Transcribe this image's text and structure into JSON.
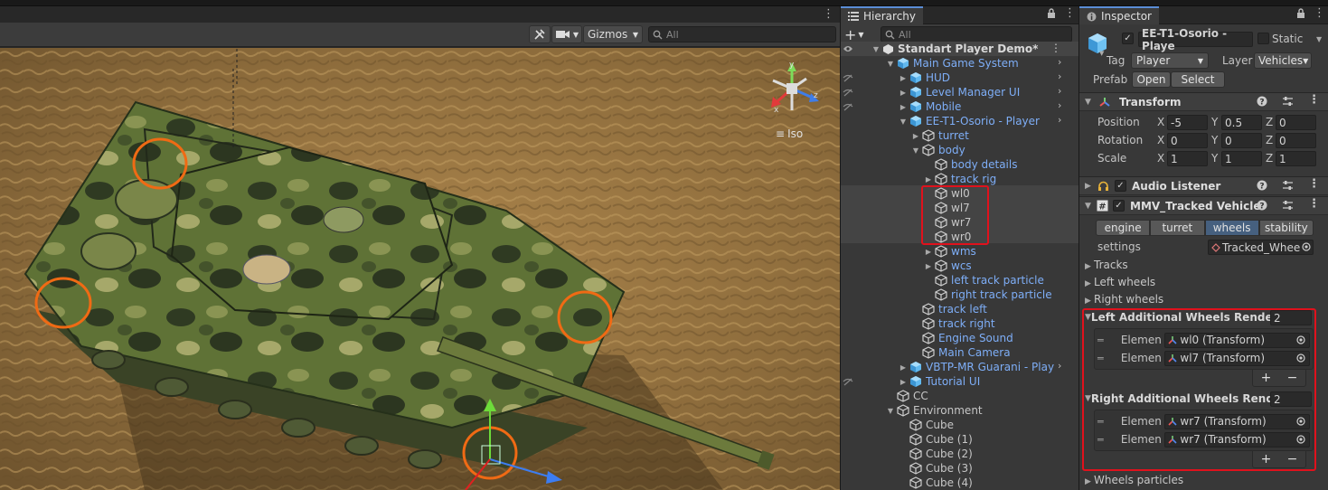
{
  "scene": {
    "gizmos_label": "Gizmos",
    "search_placeholder": "All",
    "iso_label": "Iso",
    "axis_labels": {
      "x": "x",
      "y": "y",
      "z": "z"
    }
  },
  "hierarchy": {
    "tab_label": "Hierarchy",
    "search_placeholder": "All",
    "add_label": "+",
    "scene_name": "Standart Player Demo*",
    "items": [
      {
        "label": "Main Game System",
        "depth": 1,
        "arrow": "open",
        "blue": true,
        "prefab": true,
        "more": true
      },
      {
        "label": "HUD",
        "depth": 2,
        "arrow": "closed",
        "blue": true,
        "prefab": true,
        "more": true
      },
      {
        "label": "Level Manager UI",
        "depth": 2,
        "arrow": "closed",
        "blue": true,
        "prefab": true,
        "more": true
      },
      {
        "label": "Mobile",
        "depth": 2,
        "arrow": "closed",
        "blue": true,
        "prefab": true,
        "more": true
      },
      {
        "label": "EE-T1-Osorio - Player",
        "depth": 2,
        "arrow": "open",
        "blue": true,
        "prefab": true,
        "more": true
      },
      {
        "label": "turret",
        "depth": 3,
        "arrow": "closed",
        "blue": true,
        "prefab": false
      },
      {
        "label": "body",
        "depth": 3,
        "arrow": "open",
        "blue": true,
        "prefab": false
      },
      {
        "label": "body details",
        "depth": 4,
        "arrow": "none",
        "blue": true,
        "prefab": false
      },
      {
        "label": "track rig",
        "depth": 4,
        "arrow": "closed",
        "blue": true,
        "prefab": false
      },
      {
        "label": "wl0",
        "depth": 4,
        "arrow": "none",
        "blue": false,
        "prefab": false
      },
      {
        "label": "wl7",
        "depth": 4,
        "arrow": "none",
        "blue": false,
        "prefab": false
      },
      {
        "label": "wr7",
        "depth": 4,
        "arrow": "none",
        "blue": false,
        "prefab": false
      },
      {
        "label": "wr0",
        "depth": 4,
        "arrow": "none",
        "blue": false,
        "prefab": false
      },
      {
        "label": "wms",
        "depth": 4,
        "arrow": "closed",
        "blue": true,
        "prefab": false
      },
      {
        "label": "wcs",
        "depth": 4,
        "arrow": "closed",
        "blue": true,
        "prefab": false
      },
      {
        "label": "left track particle",
        "depth": 4,
        "arrow": "none",
        "blue": true,
        "prefab": false
      },
      {
        "label": "right track particle",
        "depth": 4,
        "arrow": "none",
        "blue": true,
        "prefab": false
      },
      {
        "label": "track left",
        "depth": 3,
        "arrow": "none",
        "blue": true,
        "prefab": false
      },
      {
        "label": "track right",
        "depth": 3,
        "arrow": "none",
        "blue": true,
        "prefab": false
      },
      {
        "label": "Engine Sound",
        "depth": 3,
        "arrow": "none",
        "blue": true,
        "prefab": false
      },
      {
        "label": "Main Camera",
        "depth": 3,
        "arrow": "none",
        "blue": true,
        "prefab": false
      },
      {
        "label": "VBTP-MR Guarani - Play",
        "depth": 2,
        "arrow": "closed",
        "blue": true,
        "prefab": true,
        "more": true
      },
      {
        "label": "Tutorial UI",
        "depth": 2,
        "arrow": "closed",
        "blue": true,
        "prefab": true,
        "more": false
      },
      {
        "label": "CC",
        "depth": 1,
        "arrow": "none",
        "blue": false,
        "prefab": false
      },
      {
        "label": "Environment",
        "depth": 1,
        "arrow": "open",
        "blue": false,
        "prefab": false
      },
      {
        "label": "Cube",
        "depth": 2,
        "arrow": "none",
        "blue": false,
        "prefab": false
      },
      {
        "label": "Cube (1)",
        "depth": 2,
        "arrow": "none",
        "blue": false,
        "prefab": false
      },
      {
        "label": "Cube (2)",
        "depth": 2,
        "arrow": "none",
        "blue": false,
        "prefab": false
      },
      {
        "label": "Cube (3)",
        "depth": 2,
        "arrow": "none",
        "blue": false,
        "prefab": false
      },
      {
        "label": "Cube (4)",
        "depth": 2,
        "arrow": "none",
        "blue": false,
        "prefab": false
      }
    ]
  },
  "inspector": {
    "tab_label": "Inspector",
    "object_name": "EE-T1-Osorio - Playe",
    "static_label": "Static",
    "tag_label": "Tag",
    "tag_value": "Player",
    "layer_label": "Layer",
    "layer_value": "Vehicles",
    "prefab_label": "Prefab",
    "open_label": "Open",
    "select_label": "Select",
    "transform": {
      "title": "Transform",
      "position_label": "Position",
      "rotation_label": "Rotation",
      "scale_label": "Scale",
      "x": "X",
      "y": "Y",
      "z": "Z",
      "position": {
        "x": "-5",
        "y": "0.5",
        "z": "0"
      },
      "rotation": {
        "x": "0",
        "y": "0",
        "z": "0"
      },
      "scale": {
        "x": "1",
        "y": "1",
        "z": "1"
      }
    },
    "audio_listener": {
      "title": "Audio Listener"
    },
    "tracked": {
      "title": "MMV_Tracked Vehicle (",
      "tabs": [
        "engine",
        "turret",
        "wheels",
        "stability"
      ],
      "settings_label": "settings",
      "settings_value": "Tracked_Whee",
      "foldouts": [
        "Tracks",
        "Left wheels",
        "Right wheels"
      ],
      "left_additional": {
        "label": "Left Additional Wheels Renderer",
        "count": "2",
        "elements": [
          {
            "label": "Elemen",
            "value": "wl0 (Transform)"
          },
          {
            "label": "Elemen",
            "value": "wl7 (Transform)"
          }
        ]
      },
      "right_additional": {
        "label": "Right Additional Wheels Renderer",
        "count": "2",
        "elements": [
          {
            "label": "Elemen",
            "value": "wr7 (Transform)"
          },
          {
            "label": "Elemen",
            "value": "wr7 (Transform)"
          }
        ]
      },
      "plus": "+",
      "minus": "−",
      "wheels_particles": "Wheels particles"
    }
  }
}
